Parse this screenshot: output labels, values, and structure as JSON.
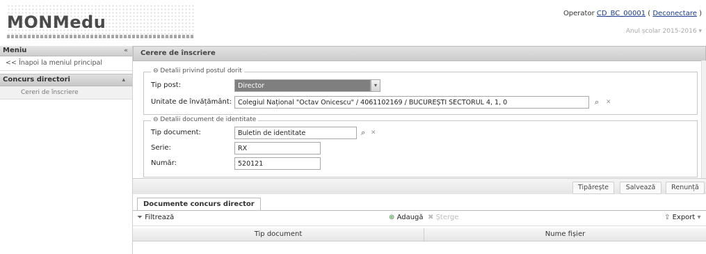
{
  "app": {
    "logo_text": "MONMedu"
  },
  "header": {
    "operator_prefix": "Operator",
    "operator_user": "CD_BC_00001",
    "logout_open": "(",
    "logout_label": "Deconectare",
    "logout_close": ")",
    "school_year": "Anul școlar 2015-2016"
  },
  "sidebar": {
    "title": "Meniu",
    "back_link": "<< Înapoi la meniul principal",
    "group_label": "Concurs directori",
    "items": [
      {
        "label": "Cereri de înscriere"
      }
    ]
  },
  "main": {
    "title": "Cerere de înscriere",
    "section1": {
      "legend": "Detalii privind postul dorit",
      "tip_post_label": "Tip post:",
      "tip_post_value": "Director",
      "unitate_label": "Unitate de învățământ:",
      "unitate_value": "Colegiul Național \"Octav Onicescu\" / 4061102169 / BUCUREȘTI SECTORUL 4, 1, 0"
    },
    "section2": {
      "legend": "Detalii document de identitate",
      "tip_doc_label": "Tip document:",
      "tip_doc_value": "Buletin de identitate",
      "serie_label": "Serie:",
      "serie_value": "RX",
      "numar_label": "Număr:",
      "numar_value": "520121"
    },
    "actions": {
      "print": "Tipărește",
      "save": "Salvează",
      "cancel": "Renunță"
    },
    "tab": {
      "label": "Documente concurs director"
    },
    "grid": {
      "filter_label": "Filtrează",
      "add_label": "Adaugă",
      "delete_label": "Șterge",
      "export_label": "Export",
      "columns": [
        "Tip document",
        "Nume fișier"
      ]
    }
  }
}
